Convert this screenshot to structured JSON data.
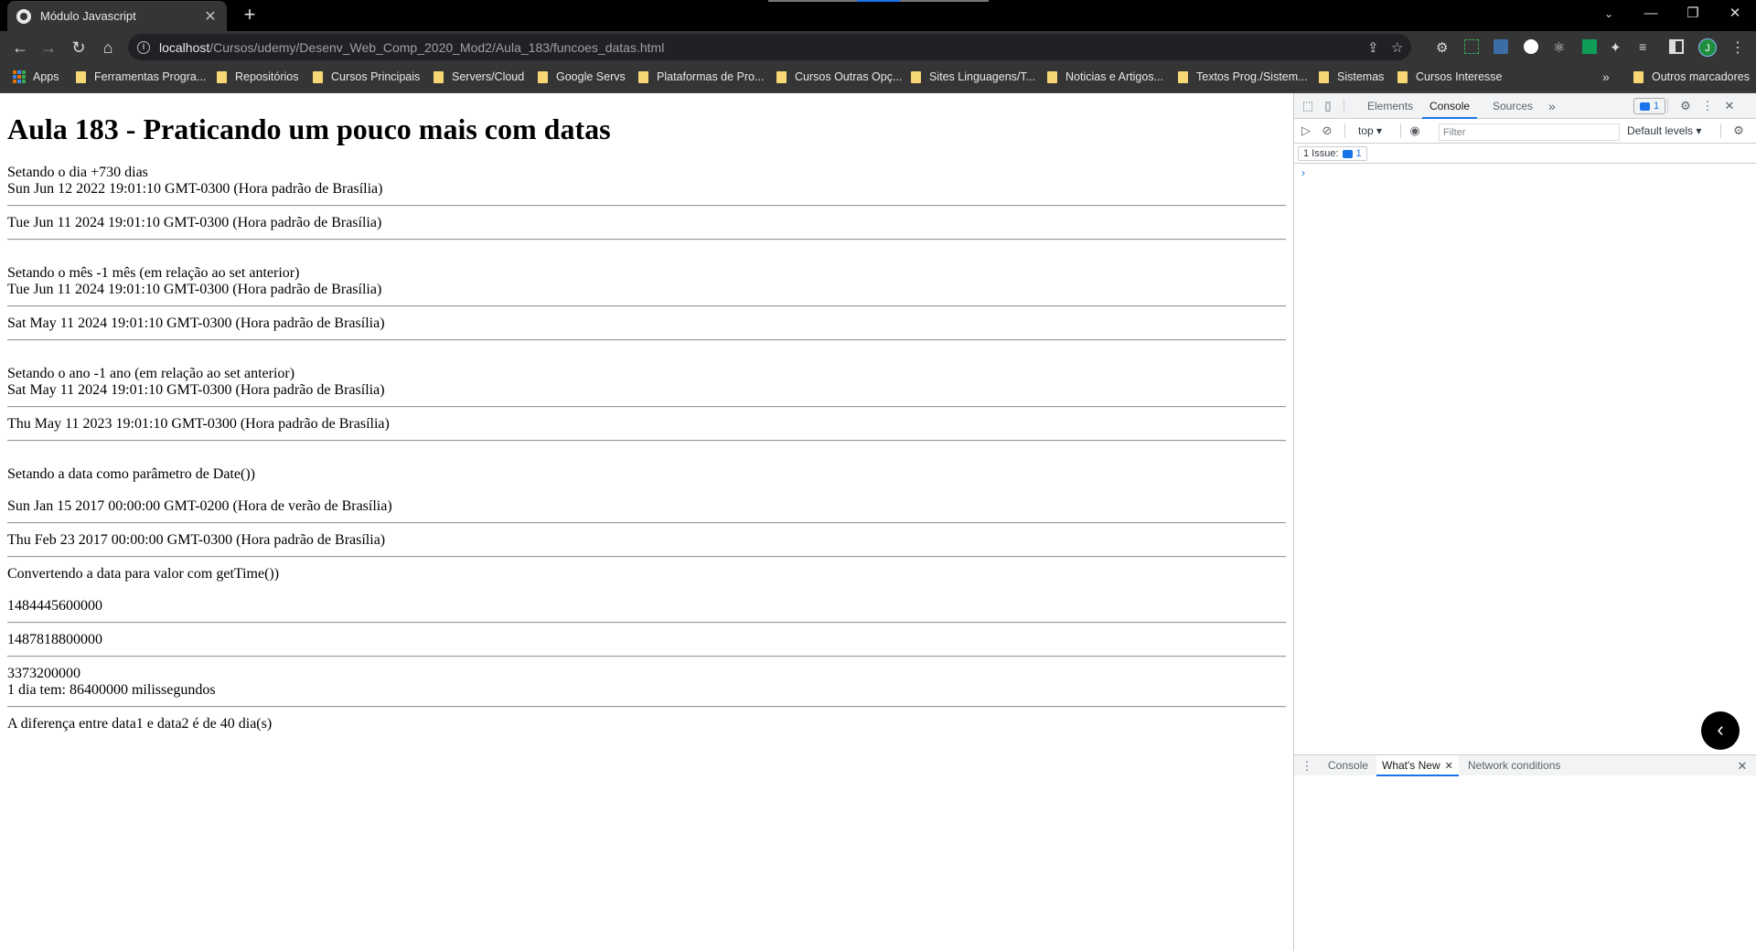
{
  "browser": {
    "tab_title": "Módulo Javascript",
    "tab_close": "✕",
    "new_tab": "+",
    "window_controls": {
      "minimize": "—",
      "restore": "❐",
      "close": "✕"
    },
    "nav": {
      "back": "←",
      "forward": "→",
      "reload": "↻",
      "home": "⌂"
    },
    "url_host": "localhost",
    "url_path": "/Cursos/udemy/Desenv_Web_Comp_2020_Mod2/Aula_183/funcoes_datas.html",
    "profile_initial": "J",
    "icons": [
      "info-icon",
      "share-icon",
      "star-icon",
      "extension-icons",
      "puzzle-icon",
      "sidepanel-icon"
    ]
  },
  "bookmarks": {
    "apps": "Apps",
    "items": [
      "Ferramentas Progra...",
      "Repositórios",
      "Cursos Principais",
      "Servers/Cloud",
      "Google Servs",
      "Plataformas de Pro...",
      "Cursos Outras Opç...",
      "Sites Linguagens/T...",
      "Noticias e Artigos...",
      "Textos Prog./Sistem...",
      "Sistemas",
      "Cursos Interesse"
    ],
    "more": "»",
    "others": "Outros marcadores"
  },
  "page": {
    "title": "Aula 183 - Praticando um pouco mais com datas",
    "section1": {
      "label": "Setando o dia +730 dias",
      "before": "Sun Jun 12 2022 19:01:10 GMT-0300 (Hora padrão de Brasília)",
      "after": "Tue Jun 11 2024 19:01:10 GMT-0300 (Hora padrão de Brasília)"
    },
    "section2": {
      "label": "Setando o mês -1 mês (em relação ao set anterior)",
      "before": "Tue Jun 11 2024 19:01:10 GMT-0300 (Hora padrão de Brasília)",
      "after": "Sat May 11 2024 19:01:10 GMT-0300 (Hora padrão de Brasília)"
    },
    "section3": {
      "label": "Setando o ano -1 ano (em relação ao set anterior)",
      "before": "Sat May 11 2024 19:01:10 GMT-0300 (Hora padrão de Brasília)",
      "after": "Thu May 11 2023 19:01:10 GMT-0300 (Hora padrão de Brasília)"
    },
    "section4": {
      "label": "Setando a data como parâmetro de Date())",
      "date1": "Sun Jan 15 2017 00:00:00 GMT-0200 (Hora de verão de Brasília)",
      "date2": "Thu Feb 23 2017 00:00:00 GMT-0300 (Hora padrão de Brasília)"
    },
    "section5": {
      "label": "Convertendo a data para valor com getTime())",
      "time1": "1484445600000",
      "time2": "1487818800000",
      "diff": "3373200000",
      "day_ms": "1 dia tem: 86400000 milissegundos"
    },
    "result": "A diferença entre data1 e data2 é de 40 dia(s)"
  },
  "devtools": {
    "tabs": [
      "Elements",
      "Console",
      "Sources"
    ],
    "active_tab": "Console",
    "more_tabs": "»",
    "issues_badge": "1",
    "context": "top",
    "filter_placeholder": "Filter",
    "levels": "Default levels",
    "issue_chip_label": "1 Issue:",
    "issue_chip_count": "1",
    "prompt": "›",
    "drawer_tabs": [
      "Console",
      "What's New",
      "Network conditions"
    ],
    "drawer_active": "What's New"
  }
}
